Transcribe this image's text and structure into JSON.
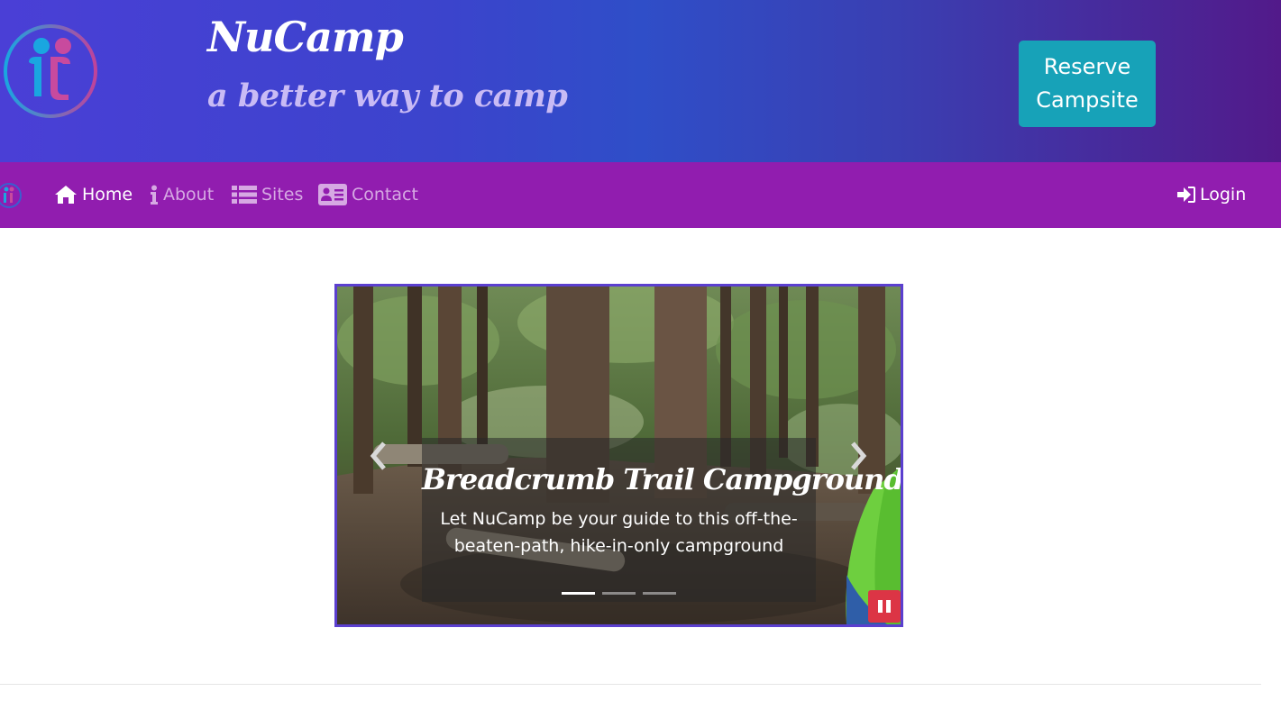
{
  "header": {
    "title": "NuCamp",
    "subtitle": "a better way to camp",
    "reserve_line1": "Reserve",
    "reserve_line2": "Campsite",
    "logo_icon": "nucamp-logo-icon"
  },
  "navbar": {
    "items": [
      {
        "label": "Home",
        "icon": "home-icon",
        "active": true
      },
      {
        "label": "About",
        "icon": "info-icon",
        "active": false
      },
      {
        "label": "Sites",
        "icon": "list-icon",
        "active": false
      },
      {
        "label": "Contact",
        "icon": "address-card-icon",
        "active": false
      }
    ],
    "login_label": "Login",
    "login_icon": "sign-in-icon"
  },
  "carousel": {
    "caption_title": "Breadcrumb Trail Campground",
    "caption_text": "Let NuCamp be your guide to this off-the-beaten-path, hike-in-only campground",
    "slide_count": 3,
    "active_slide": 1
  },
  "colors": {
    "navbar": "#911daf",
    "reserve_button": "#17a2b8",
    "pause_button": "#dc3545",
    "carousel_border": "#5b3fcf"
  }
}
